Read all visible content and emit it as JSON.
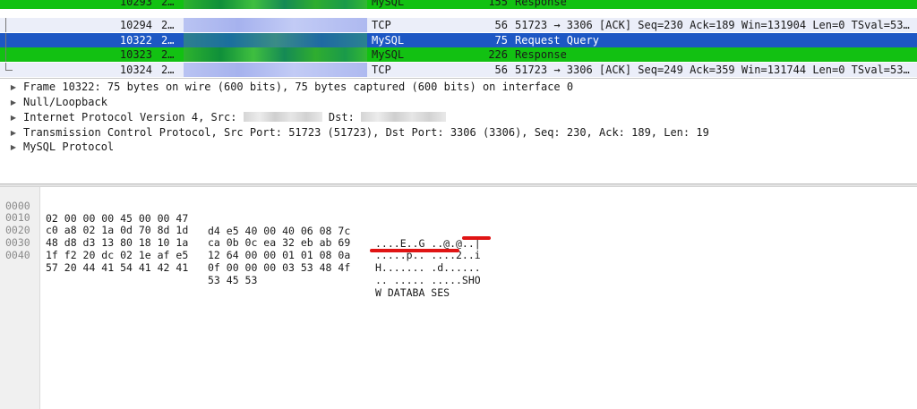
{
  "packet_list": {
    "rows": [
      {
        "no": "10293",
        "time": "2…",
        "protocol": "MySQL",
        "length": "155",
        "info": "Response",
        "style": "green"
      },
      {
        "no": "10294",
        "time": "2…",
        "protocol": "TCP",
        "length": "56",
        "info": "51723 → 3306 [ACK] Seq=230 Ack=189 Win=131904 Len=0 TSval=53…",
        "style": "light"
      },
      {
        "no": "10322",
        "time": "2…",
        "protocol": "MySQL",
        "length": "75",
        "info": "Request Query",
        "style": "selected"
      },
      {
        "no": "10323",
        "time": "2…",
        "protocol": "MySQL",
        "length": "226",
        "info": "Response",
        "style": "green"
      },
      {
        "no": "10324",
        "time": "2…",
        "protocol": "TCP",
        "length": "56",
        "info": "51723 → 3306 [ACK] Seq=249 Ack=359 Win=131744 Len=0 TSval=53…",
        "style": "light"
      }
    ]
  },
  "details": {
    "frame": "Frame 10322: 75 bytes on wire (600 bits), 75 bytes captured (600 bits) on interface 0",
    "null_loopback": "Null/Loopback",
    "ip_src_prefix": "Internet Protocol Version 4, Src:",
    "ip_dst_label": "Dst:",
    "tcp": "Transmission Control Protocol, Src Port: 51723 (51723), Dst Port: 3306 (3306), Seq: 230, Ack: 189, Len: 19",
    "mysql": "MySQL Protocol"
  },
  "bytes": {
    "rows": [
      {
        "offset": "0000",
        "hex1": "02 00 00 00 45 00 00 47",
        "hex2": "d4 e5 40 00 40 06 08 7c",
        "ascii": "....E..G ..@.@..|"
      },
      {
        "offset": "0010",
        "hex1": "c0 a8 02 1a 0d 70 8d 1d",
        "hex2": "ca 0b 0c ea 32 eb ab 69",
        "ascii": ".....p.. ....2..i"
      },
      {
        "offset": "0020",
        "hex1": "48 d8 d3 13 80 18 10 1a",
        "hex2": "12 64 00 00 01 01 08 0a",
        "ascii": "H....... .d......"
      },
      {
        "offset": "0030",
        "hex1": "1f f2 20 dc 02 1e af e5",
        "hex2": "0f 00 00 00 03 53 48 4f",
        "ascii": ".. ..... .....SHO"
      },
      {
        "offset": "0040",
        "hex1": "57 20 44 41 54 41 42 41",
        "hex2": "53 45 53",
        "ascii": "W DATABA SES"
      }
    ]
  },
  "annotation_color": "#e01414",
  "colors": {
    "green_row": "#12c112",
    "light_row": "#ebeef9",
    "selected_row": "#1d57c4"
  },
  "icons": {
    "collapsed": "triangle-right-icon"
  }
}
